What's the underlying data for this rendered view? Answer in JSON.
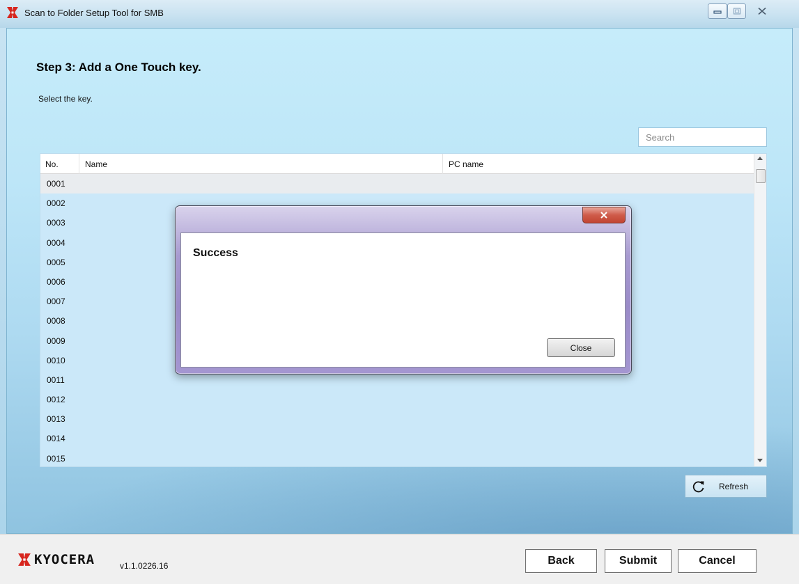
{
  "window": {
    "title": "Scan to Folder Setup Tool for SMB",
    "controls": [
      "minimize-icon",
      "maximize-icon",
      "close-icon"
    ]
  },
  "step": {
    "title": "Step 3: Add a One Touch key.",
    "instruction": "Select the key."
  },
  "search": {
    "placeholder": "Search"
  },
  "table": {
    "columns": {
      "no": "No.",
      "name": "Name",
      "pc_name": "PC name"
    },
    "selected_index": 0,
    "rows": [
      {
        "no": "0001"
      },
      {
        "no": "0002"
      },
      {
        "no": "0003"
      },
      {
        "no": "0004"
      },
      {
        "no": "0005"
      },
      {
        "no": "0006"
      },
      {
        "no": "0007"
      },
      {
        "no": "0008"
      },
      {
        "no": "0009"
      },
      {
        "no": "0010"
      },
      {
        "no": "0011"
      },
      {
        "no": "0012"
      },
      {
        "no": "0013"
      },
      {
        "no": "0014"
      },
      {
        "no": "0015"
      }
    ]
  },
  "refresh": {
    "label": "Refresh",
    "icon": "refresh-icon"
  },
  "footer": {
    "brand": "KYOCERA",
    "brand_color": "#d7261e",
    "version": "v1.1.0226.16",
    "back_label": "Back",
    "submit_label": "Submit",
    "cancel_label": "Cancel"
  },
  "dialog": {
    "message": "Success",
    "close_label": "Close"
  }
}
